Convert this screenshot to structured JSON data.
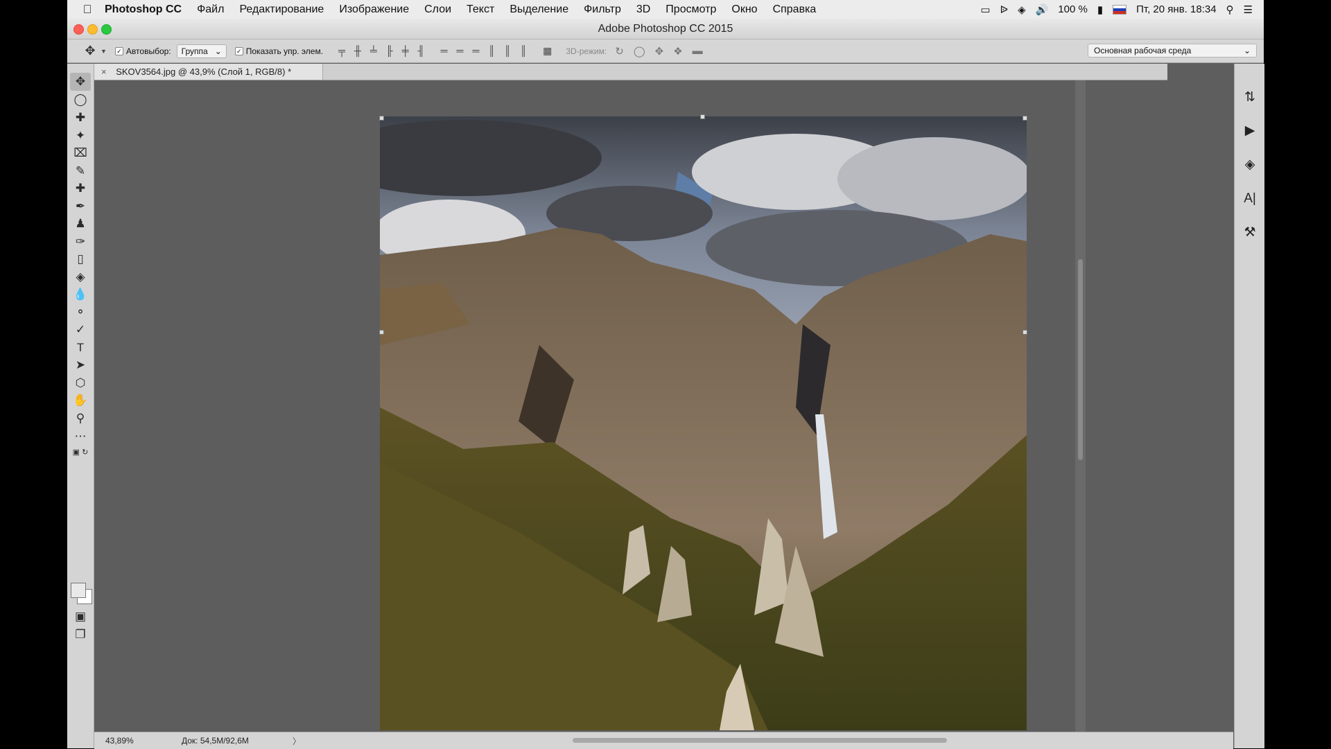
{
  "menubar": {
    "apple_icon": "apple-icon",
    "app_name": "Photoshop CC",
    "items": [
      "Файл",
      "Редактирование",
      "Изображение",
      "Слои",
      "Текст",
      "Выделение",
      "Фильтр",
      "3D",
      "Просмотр",
      "Окно",
      "Справка"
    ],
    "battery": "100 %",
    "clock": "Пт, 20 янв. 18:34"
  },
  "window": {
    "title": "Adobe Photoshop CC 2015"
  },
  "options_bar": {
    "autoselect_label": "Автовыбор:",
    "autoselect_checked": true,
    "group_select": "Группа",
    "show_controls_label": "Показать упр. элем.",
    "show_controls_checked": true,
    "mode_3d_label": "3D-режим:",
    "workspace": "Основная рабочая среда"
  },
  "document": {
    "tab_title": "SKOV3564.jpg @ 43,9% (Слой 1, RGB/8) *",
    "tab_close": "×"
  },
  "status_bar": {
    "zoom": "43,89%",
    "doc_info": "Док: 54,5M/92,6M",
    "more": "〉"
  },
  "colors": {
    "foreground": "#e9e9e9",
    "background": "#ffffff"
  }
}
